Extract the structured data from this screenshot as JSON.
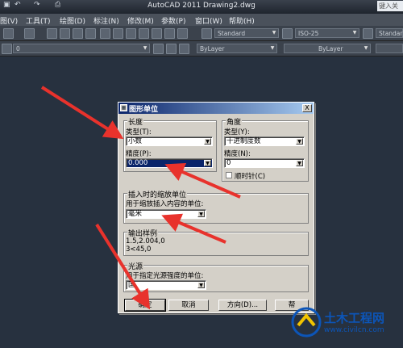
{
  "window": {
    "title": "AutoCAD 2011    Drawing2.dwg",
    "search_placeholder": "键入关"
  },
  "menu": [
    "图(V)",
    "工具(T)",
    "绘图(D)",
    "标注(N)",
    "修改(M)",
    "参数(P)",
    "窗口(W)",
    "帮助(H)"
  ],
  "toolbar": {
    "text_style": "Standard",
    "dim_style": "ISO-25",
    "table_style": "Standar",
    "layer": "0",
    "color": "ByLayer",
    "linetype": "ByLayer"
  },
  "dialog": {
    "title": "图形单位",
    "close_label": "X",
    "length": {
      "group_label": "长度",
      "type_label": "类型(T):",
      "type_value": "小数",
      "precision_label": "精度(P):",
      "precision_value": "0.000"
    },
    "angle": {
      "group_label": "角度",
      "type_label": "类型(Y):",
      "type_value": "十进制度数",
      "precision_label": "精度(N):",
      "precision_value": "0",
      "clockwise_label": "顺时针(C)"
    },
    "insertion": {
      "group_label": "插入时的缩放单位",
      "desc": "用于缩放插入内容的单位:",
      "value": "毫米"
    },
    "sample": {
      "group_label": "输出样例",
      "line1": "1.5,2.004,0",
      "line2": "3<45,0"
    },
    "lighting": {
      "group_label": "光源",
      "desc": "用于指定光源强度的单位:",
      "value": "国"
    },
    "buttons": {
      "ok": "确定",
      "cancel": "取消",
      "direction": "方向(D)...",
      "help": "帮"
    }
  },
  "watermark": {
    "name": "土木工程网",
    "url": "www.civilcn.com"
  },
  "colors": {
    "arrow": "#e8322c",
    "dialog_bg": "#d4d0c8",
    "title_blue": "#0a246a",
    "canvas_bg": "#27313f"
  }
}
